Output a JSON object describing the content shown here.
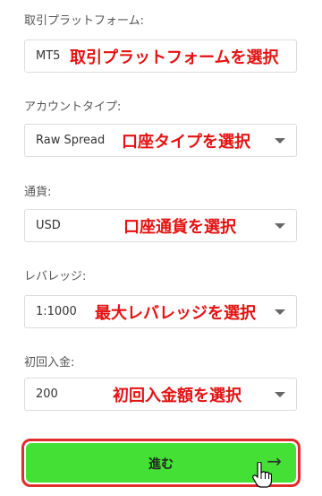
{
  "fields": {
    "platform": {
      "label": "取引プラットフォーム:",
      "value": "MT5",
      "annotation": "取引プラットフォームを選択"
    },
    "account_type": {
      "label": "アカウントタイプ:",
      "value": "Raw Spread",
      "annotation": "口座タイプを選択"
    },
    "currency": {
      "label": "通貨:",
      "value": "USD",
      "annotation": "口座通貨を選択"
    },
    "leverage": {
      "label": "レバレッジ:",
      "value": "1:1000",
      "annotation": "最大レバレッジを選択"
    },
    "initial_deposit": {
      "label": "初回入金:",
      "value": "200",
      "annotation": "初回入金額を選択"
    }
  },
  "submit": {
    "label": "進む",
    "arrow": "→"
  },
  "icons": {
    "chevron": "chevron-down-icon",
    "arrow": "arrow-right-icon",
    "cursor": "hand-cursor-icon"
  },
  "colors": {
    "annotation": "#e41212",
    "button": "#45e035",
    "button_outline": "#e22b2b"
  }
}
